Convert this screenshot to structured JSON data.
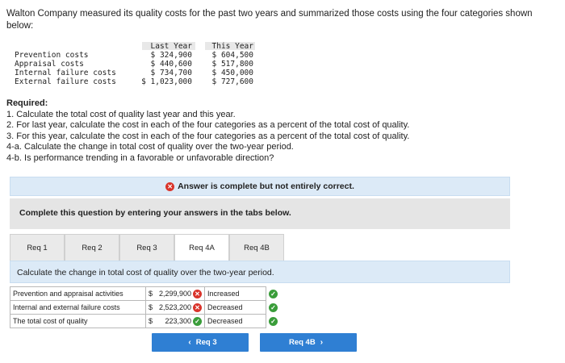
{
  "intro": "Walton Company measured its quality costs for the past two years and summarized those costs using the four categories shown below:",
  "cost_table": {
    "col_last_year": "Last Year",
    "col_this_year": "This Year",
    "rows": [
      {
        "label": "Prevention costs",
        "last": "$ 324,900",
        "this": "$ 604,500"
      },
      {
        "label": "Appraisal costs",
        "last": "$ 440,600",
        "this": "$ 517,800"
      },
      {
        "label": "Internal failure costs",
        "last": "$ 734,700",
        "this": "$ 450,000"
      },
      {
        "label": "External failure costs",
        "last": "$ 1,023,000",
        "this": "$ 727,600"
      }
    ]
  },
  "required": {
    "title": "Required:",
    "items": [
      "1. Calculate the total cost of quality last year and this year.",
      "2. For last year, calculate the cost in each of the four categories as a percent of the total cost of quality.",
      "3. For this year, calculate the cost in each of the four categories as a percent of the total cost of quality.",
      "4-a. Calculate the change in total cost of quality over the two-year period.",
      "4-b. Is performance trending in a favorable or unfavorable direction?"
    ]
  },
  "banner": "Answer is complete but not entirely correct.",
  "instruction": "Complete this question by entering your answers in the tabs below.",
  "tabs": [
    "Req 1",
    "Req 2",
    "Req 3",
    "Req 4A",
    "Req 4B"
  ],
  "active_tab": "Req 4A",
  "panel_text": "Calculate the change in total cost of quality over the two-year period.",
  "answers": [
    {
      "label": "Prevention and appraisal activities",
      "currency": "$",
      "amount": "2,299,900",
      "amount_status": "incorrect",
      "direction": "Increased",
      "direction_status": "correct"
    },
    {
      "label": "Internal and external failure costs",
      "currency": "$",
      "amount": "2,523,200",
      "amount_status": "incorrect",
      "direction": "Decreased",
      "direction_status": "correct"
    },
    {
      "label": "The total cost of quality",
      "currency": "$",
      "amount": "223,300",
      "amount_status": "correct",
      "direction": "Decreased",
      "direction_status": "correct"
    }
  ],
  "nav": {
    "prev_label": "Req 3",
    "next_label": "Req 4B"
  },
  "colors": {
    "accent": "#2f7fd3",
    "banner_bg": "#dceaf7",
    "incorrect": "#d9342b",
    "correct": "#3a9d3a"
  }
}
